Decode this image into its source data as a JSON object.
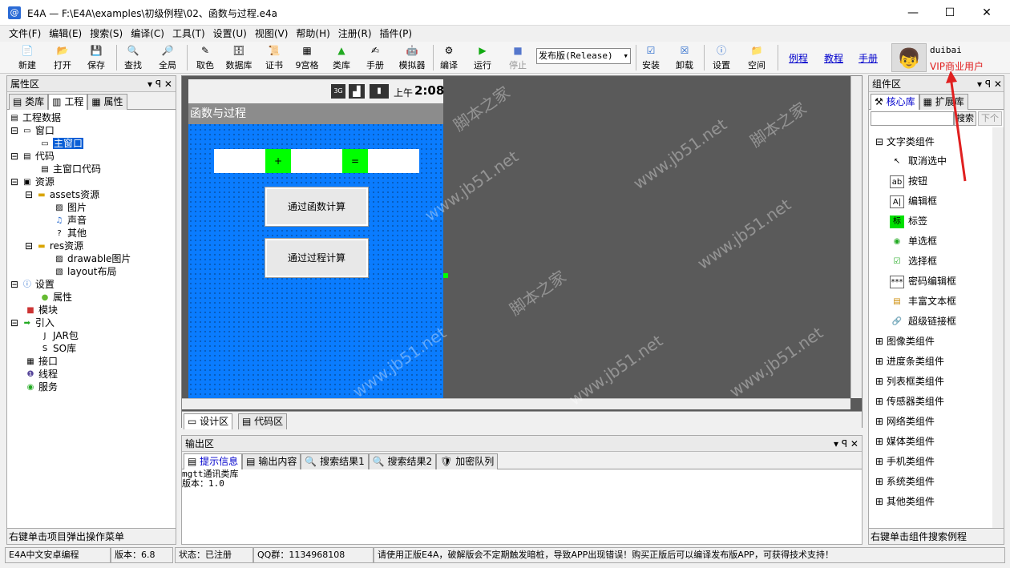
{
  "window": {
    "title": "E4A — F:\\E4A\\examples\\初级例程\\02、函数与过程.e4a",
    "app_icon": "@",
    "min": "—",
    "max": "☐",
    "close": "✕"
  },
  "menu": [
    "文件(F)",
    "编辑(E)",
    "搜索(S)",
    "编译(C)",
    "工具(T)",
    "设置(U)",
    "视图(V)",
    "帮助(H)",
    "注册(R)",
    "插件(P)"
  ],
  "toolbar": {
    "new": "新建",
    "open": "打开",
    "save": "保存",
    "find": "查找",
    "all": "全局",
    "color": "取色",
    "db": "数据库",
    "cert": "证书",
    "grid9": "9宫格",
    "lib": "类库",
    "manual": "手册",
    "emu": "模拟器",
    "compile": "编译",
    "run": "运行",
    "stop": "停止",
    "build_mode": "发布版(Release)",
    "install": "安装",
    "uninstall": "卸载",
    "settings": "设置",
    "space": "空间",
    "link_examples": "例程",
    "link_tutorial": "教程",
    "link_manual": "手册",
    "user_name": "duibai",
    "user_type": "VIP商业用户"
  },
  "left_panel": {
    "title": "属性区",
    "tabs": [
      "类库",
      "工程",
      "属性"
    ],
    "tree": [
      {
        "label": "工程数据"
      },
      {
        "label": "窗口"
      },
      {
        "label": "主窗口"
      },
      {
        "label": "代码"
      },
      {
        "label": "主窗口代码"
      },
      {
        "label": "资源"
      },
      {
        "label": "assets资源"
      },
      {
        "label": "图片"
      },
      {
        "label": "声音"
      },
      {
        "label": "其他"
      },
      {
        "label": "res资源"
      },
      {
        "label": "drawable图片"
      },
      {
        "label": "layout布局"
      },
      {
        "label": "设置"
      },
      {
        "label": "属性"
      },
      {
        "label": "模块"
      },
      {
        "label": "引入"
      },
      {
        "label": "JAR包"
      },
      {
        "label": "SO库"
      },
      {
        "label": "接口"
      },
      {
        "label": "线程"
      },
      {
        "label": "服务"
      }
    ],
    "hint": "右键单击项目弹出操作菜单"
  },
  "designer": {
    "phone_time": "2:08",
    "phone_ampm": "上午",
    "phone_net": "3G",
    "form_title": "函数与过程",
    "plus": "+",
    "equals": "=",
    "btn_func": "通过函数计算",
    "btn_proc": "通过过程计算",
    "tab_design": "设计区",
    "tab_code": "代码区"
  },
  "output": {
    "title": "输出区",
    "tabs": [
      "提示信息",
      "输出内容",
      "搜索结果1",
      "搜索结果2",
      "加密队列"
    ],
    "line1": "mgtt通讯类库",
    "line2": "版本：1.0"
  },
  "right_panel": {
    "title": "组件区",
    "tabs": [
      "核心库",
      "扩展库"
    ],
    "search_btn": "搜索",
    "next_btn": "下个",
    "text_group": "文字类组件",
    "items": [
      "取消选中",
      "按钮",
      "编辑框",
      "标签",
      "单选框",
      "选择框",
      "密码编辑框",
      "丰富文本框",
      "超级链接框"
    ],
    "groups": [
      "图像类组件",
      "进度条类组件",
      "列表框类组件",
      "传感器类组件",
      "网络类组件",
      "媒体类组件",
      "手机类组件",
      "系统类组件",
      "其他类组件"
    ],
    "hint": "右键单击组件搜索例程"
  },
  "statusbar": {
    "s1": "E4A中文安卓编程",
    "s2": "版本：6.8",
    "s3": "状态：已注册",
    "s4": "QQ群：1134968108",
    "s5": "请使用正版E4A，破解版会不定期触发暗桩，导致APP出现错误！购买正版后可以编译发布版APP，可获得技术支持！"
  },
  "watermark": {
    "a": "www.jb51.net",
    "b": "脚本之家"
  },
  "colors": {
    "form_bg": "#0a7cff",
    "green": "#00ff00",
    "accent_red": "#e02020",
    "link": "#0000cc"
  }
}
